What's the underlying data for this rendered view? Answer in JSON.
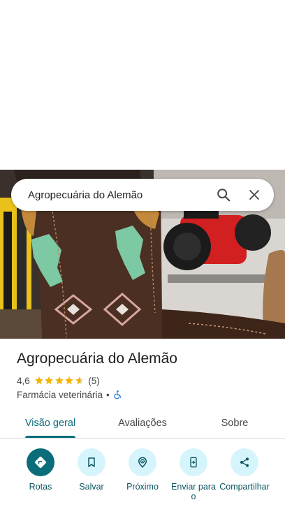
{
  "search": {
    "query": "Agropecuária do Alemão"
  },
  "place": {
    "name": "Agropecuária do Alemão",
    "rating": "4,6",
    "rating_value": 4.6,
    "review_count": "(5)",
    "category": "Farmácia veterinária",
    "separator": "•"
  },
  "tabs": [
    {
      "label": "Visão geral",
      "active": true
    },
    {
      "label": "Avaliações",
      "active": false
    },
    {
      "label": "Sobre",
      "active": false
    }
  ],
  "actions": [
    {
      "label": "Rotas",
      "icon": "directions-icon"
    },
    {
      "label": "Salvar",
      "icon": "bookmark-icon"
    },
    {
      "label": "Próximo",
      "icon": "nearby-icon"
    },
    {
      "label": "Enviar para o",
      "icon": "send-to-phone-icon"
    },
    {
      "label": "Compartilhar",
      "icon": "share-icon"
    }
  ],
  "colors": {
    "accent": "#0b6d7a",
    "action_bg": "#d6f4fb",
    "star": "#f4b400",
    "accessibility": "#1a73e8"
  }
}
